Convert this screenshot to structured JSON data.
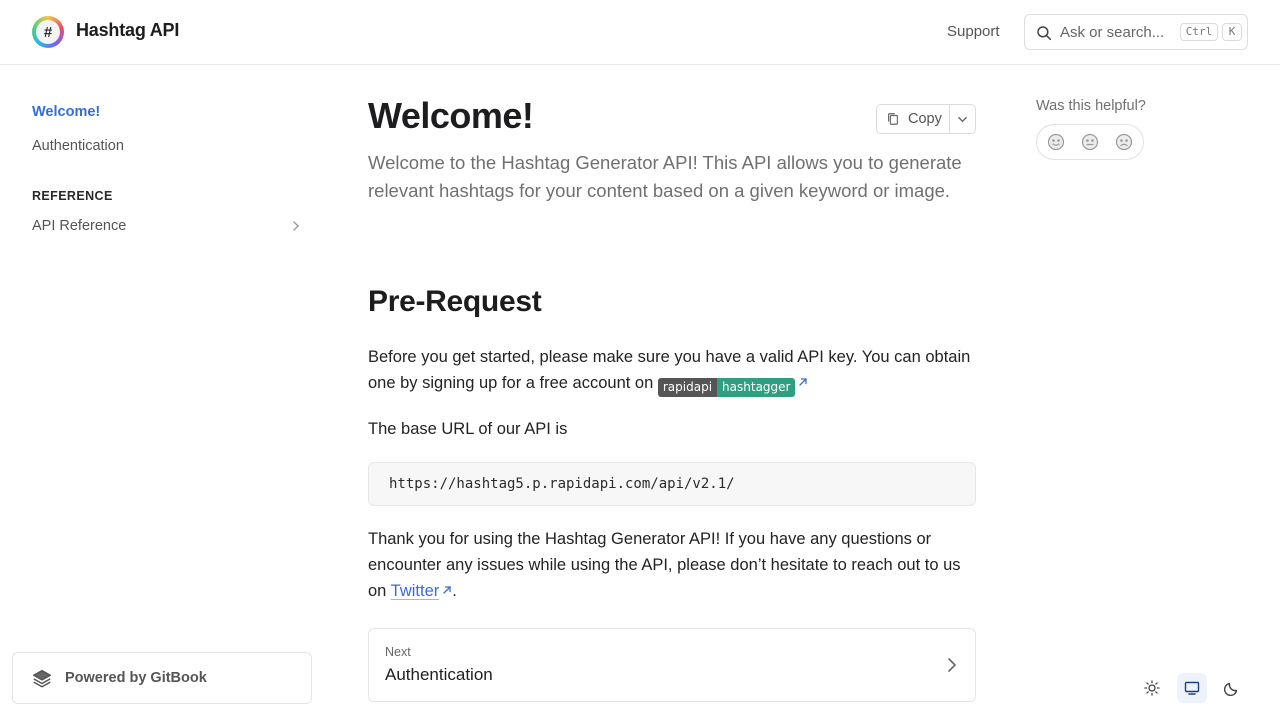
{
  "header": {
    "logo_glyph": "#",
    "brand": "Hashtag API",
    "support": "Support",
    "search": {
      "placeholder": "Ask or search...",
      "shortcut_mod": "Ctrl",
      "shortcut_key": "K"
    }
  },
  "sidebar": {
    "items": [
      {
        "label": "Welcome!",
        "active": true
      },
      {
        "label": "Authentication",
        "active": false
      }
    ],
    "section_heading": "REFERENCE",
    "reference_items": [
      {
        "label": "API Reference"
      }
    ],
    "powered_by": "Powered by GitBook"
  },
  "main": {
    "title": "Welcome!",
    "copy_label": "Copy",
    "lead": "Welcome to the Hashtag Generator API! This API allows you to generate relevant hashtags for your content based on a given keyword or image.",
    "section_title": "Pre-Request",
    "para1_text": "Before you get started, please make sure you have a valid API key. You can obtain one by signing up for a free account on",
    "badge_left": "rapidapi",
    "badge_right": "hashtagger",
    "para2_text": "The base URL of our API is",
    "code": "https://hashtag5.p.rapidapi.com/api/v2.1/",
    "para3_text": "Thank you for using the Hashtag Generator API! If you have any questions or encounter any issues while using the API, please don’t hesitate to reach out to us on",
    "para3_link": "Twitter",
    "para3_end": ".",
    "next": {
      "small": "Next",
      "title": "Authentication"
    }
  },
  "feedback": {
    "question": "Was this helpful?"
  },
  "colors": {
    "accent": "#346ddb",
    "badge_left": "#555555",
    "badge_right": "#2e9f80"
  }
}
